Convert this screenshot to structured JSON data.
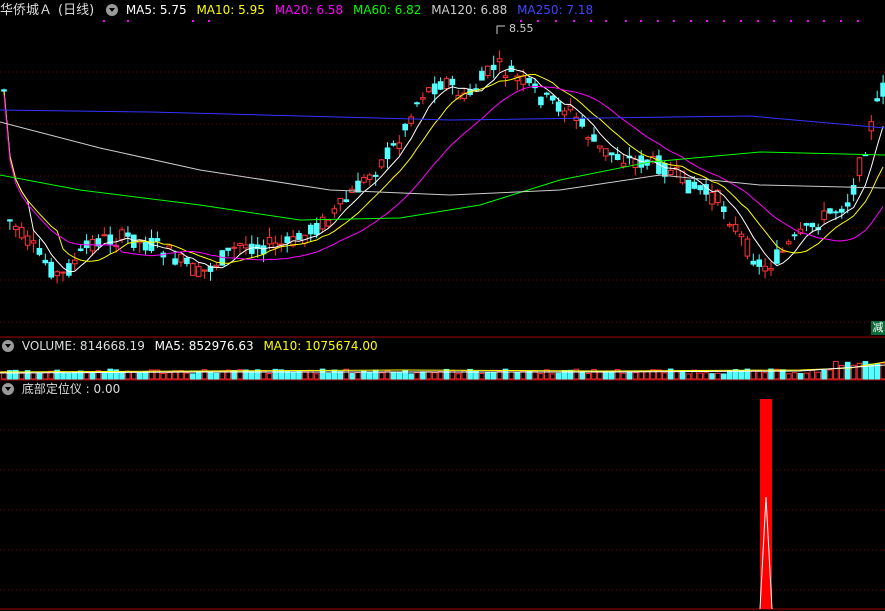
{
  "header": {
    "stock_name": "华侨城Ａ",
    "period": "(日线)",
    "ma5": "MA5: 5.75",
    "ma10": "MA10: 5.95",
    "ma20": "MA20: 6.58",
    "ma60": "MA60: 6.82",
    "ma120": "MA120: 6.88",
    "ma250": "MA250: 7.18"
  },
  "colors": {
    "ma5": "#ffffff",
    "ma10": "#ffff00",
    "ma20": "#ff00ff",
    "ma60": "#00ff00",
    "ma120": "#cccccc",
    "ma250": "#3333ff",
    "up": "#ff3333",
    "down": "#54ffff",
    "grid": "#7a0000"
  },
  "price_peak_label": "8.55",
  "scale_tag": "减",
  "volume_header": {
    "volume": "VOLUME: 814668.19",
    "ma5": "MA5: 852976.63",
    "ma10": "MA10: 1075674.00"
  },
  "indicator_header": {
    "name": "底部定位仪",
    "value": ": 0.00"
  }
}
